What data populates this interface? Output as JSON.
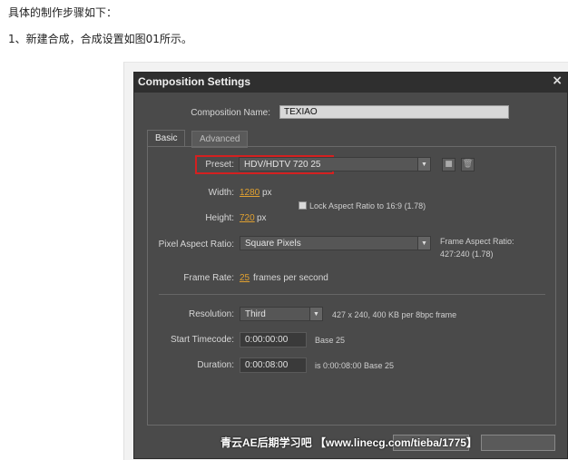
{
  "article": {
    "line1": "具体的制作步骤如下：",
    "line2": "1、新建合成，合成设置如图01所示。"
  },
  "dialog": {
    "title": "Composition Settings",
    "close_glyph": "×",
    "comp_name_label": "Composition Name:",
    "comp_name_value": "TEXIAO",
    "tabs": [
      {
        "label": "Basic",
        "active": true
      },
      {
        "label": "Advanced",
        "active": false
      }
    ],
    "preset_label": "Preset:",
    "preset_value": "HDV/HDTV 720 25",
    "width_label": "Width:",
    "width_value": "1280",
    "width_unit": "px",
    "height_label": "Height:",
    "height_value": "720",
    "height_unit": "px",
    "lock_label": "Lock Aspect Ratio to 16:9 (1.78)",
    "lock_checked": false,
    "par_label": "Pixel Aspect Ratio:",
    "par_value": "Square Pixels",
    "frame_aspect_label": "Frame Aspect Ratio:",
    "frame_aspect_value": "427:240 (1.78)",
    "frame_rate_label": "Frame Rate:",
    "frame_rate_value": "25",
    "frame_rate_unit": "frames per second",
    "resolution_label": "Resolution:",
    "resolution_value": "Third",
    "resolution_info": "427 x 240, 400 KB per 8bpc frame",
    "start_tc_label": "Start Timecode:",
    "start_tc_value": "0:00:00:00",
    "start_tc_base": "Base 25",
    "duration_label": "Duration:",
    "duration_value": "0:00:08:00",
    "duration_info": "is 0:00:08:00  Base 25"
  },
  "watermark": "青云AE后期学习吧 【www.linecg.com/tieba/1775】",
  "colors": {
    "dialog_bg": "#4a4a4a",
    "titlebar_bg": "#2f2f2f",
    "highlight_red": "#d42020",
    "link_orange": "#e0a030"
  }
}
